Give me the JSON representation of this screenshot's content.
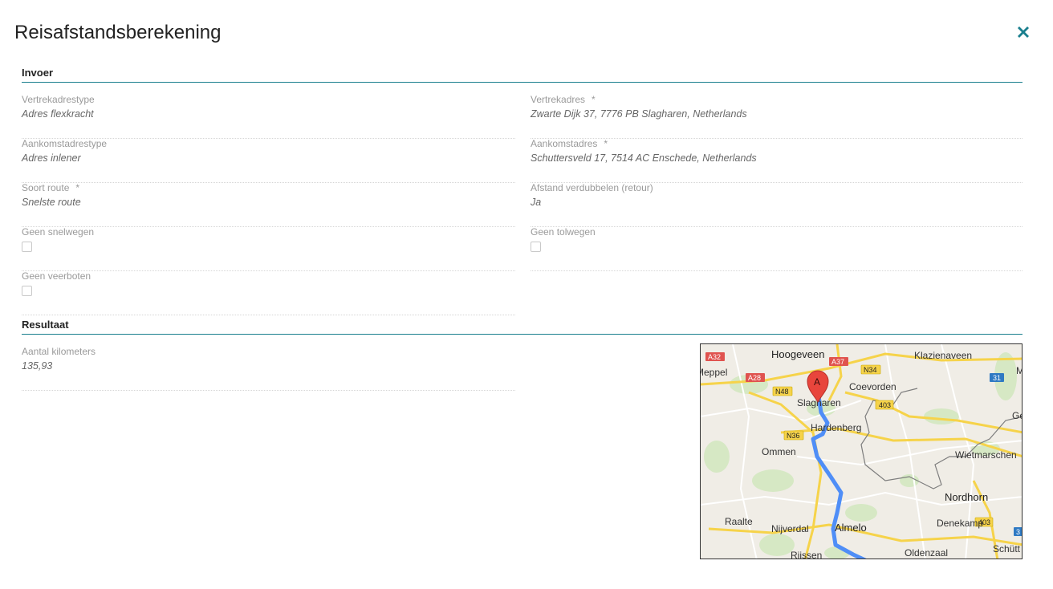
{
  "header": {
    "title": "Reisafstandsberekening"
  },
  "sections": {
    "invoer": "Invoer",
    "resultaat": "Resultaat"
  },
  "fields": {
    "vertrekadrestype": {
      "label": "Vertrekadrestype",
      "value": "Adres flexkracht"
    },
    "vertrekadres": {
      "label": "Vertrekadres",
      "required": "*",
      "value": "Zwarte Dijk 37, 7776 PB Slagharen, Netherlands"
    },
    "aankomstadrestype": {
      "label": "Aankomstadrestype",
      "value": "Adres inlener"
    },
    "aankomstadres": {
      "label": "Aankomstadres",
      "required": "*",
      "value": "Schuttersveld 17, 7514 AC Enschede, Netherlands"
    },
    "soort_route": {
      "label": "Soort route",
      "required": "*",
      "value": "Snelste route"
    },
    "afstand_verdubbelen": {
      "label": "Afstand verdubbelen (retour)",
      "value": "Ja"
    },
    "geen_snelwegen": {
      "label": "Geen snelwegen",
      "checked": false
    },
    "geen_tolwegen": {
      "label": "Geen tolwegen",
      "checked": false
    },
    "geen_veerboten": {
      "label": "Geen veerboten",
      "checked": false
    },
    "aantal_kilometers": {
      "label": "Aantal kilometers",
      "value": "135,93"
    }
  },
  "map": {
    "marker": "A",
    "places": {
      "hoogeveen": "Hoogeveen",
      "klazienaveen": "Klazienaveen",
      "meppel": "Meppel",
      "coevorden": "Coevorden",
      "slagharen": "Slagharen",
      "hardenberg": "Hardenberg",
      "ommen": "Ommen",
      "wietmarschen": "Wietmarschen",
      "nordhorn": "Nordhorn",
      "raalte": "Raalte",
      "nijverdal": "Nijverdal",
      "almelo": "Almelo",
      "denekamp": "Denekamp",
      "oldenzaal": "Oldenzaal",
      "rijssen": "Rijssen",
      "schuttorf": "Schütt",
      "ge": "Ge",
      "m": "M"
    },
    "roads": {
      "a32": "A32",
      "a37": "A37",
      "a28": "A28",
      "n34": "N34",
      "n48": "N48",
      "n36": "N36",
      "r403a": "403",
      "r403b": "403",
      "r31": "31",
      "r3": "3"
    },
    "colors": {
      "route": "#4f8ef7",
      "marker": "#e8453c",
      "border": "#7d7d7d",
      "road_yellow": "#f6d34a",
      "road_red": "#e0534f"
    }
  },
  "icons": {
    "close": "close-icon"
  }
}
